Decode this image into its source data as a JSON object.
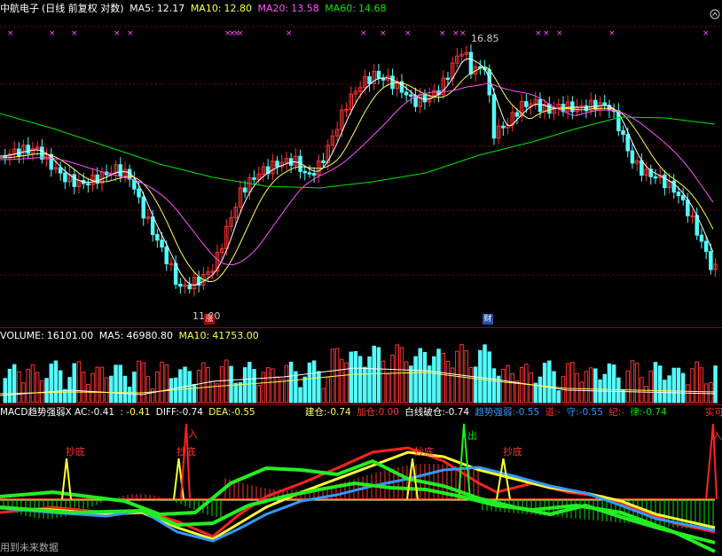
{
  "header": {
    "stock": "中航电子",
    "mode": "(日线 前复权 对数)",
    "ma5_label": "MA5:",
    "ma5": "12.17",
    "ma10_label": "MA10:",
    "ma10": "12.80",
    "ma20_label": "MA20:",
    "ma20": "13.58",
    "ma60_label": "MA60:",
    "ma60": "14.68"
  },
  "annotations": {
    "high": "16.85",
    "low": "11.00",
    "badge_rise": "涨",
    "badge_fin": "财"
  },
  "volume_header": {
    "vol_label": "VOLUME:",
    "vol": "16101.00",
    "ma5_label": "MA5:",
    "ma5": "46980.80",
    "ma10_label": "MA10:",
    "ma10": "41753.00"
  },
  "macd_header": {
    "title": "MACD趋势强弱X",
    "ac_label": "AC:",
    "ac": "-0.41",
    "colon_val": ": -0.41",
    "diff_label": "DIFF:",
    "diff": "-0.74",
    "dea_label": "DEA:",
    "dea": "-0.55",
    "jiancang_label": "建仓:",
    "jiancang": "-0.74",
    "jiacang_label": "加仓:",
    "jiacang": "0.00",
    "baixian_label": "白线破仓:",
    "baixian": "-0.74",
    "qushi_label": "趋势强弱:",
    "qushi": "-0.55",
    "dao_label": "道:",
    "dao": "-",
    "shou_label": "守:",
    "shou": "-0.55",
    "ji_label": "纪:",
    "ji": "-",
    "lv_label": "律:",
    "lv": "-0.74",
    "shidi": "实可"
  },
  "signals": {
    "chaodi": "抄底",
    "ru": "入",
    "chu": "出"
  },
  "footer": "用到未来数据",
  "colors": {
    "up": "#ff3333",
    "down": "#54fcfc",
    "ma5": "#ffffff",
    "ma10": "#ffff54",
    "ma20": "#ff54ff",
    "ma60": "#00e600",
    "marker": "#ff54ff"
  }
}
